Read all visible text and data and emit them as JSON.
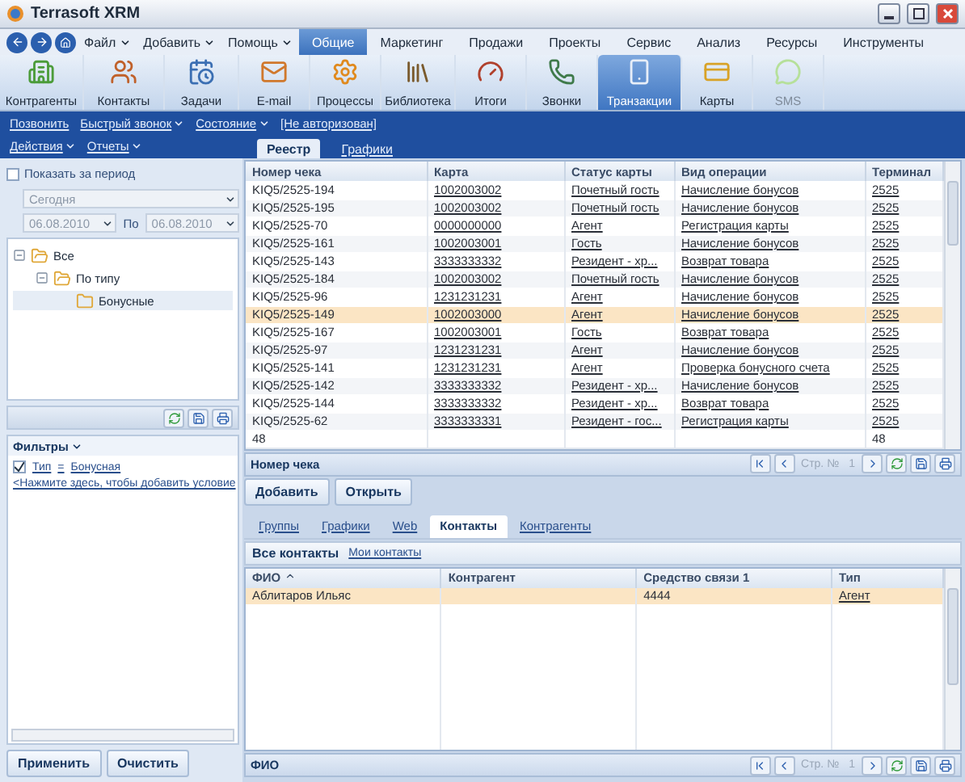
{
  "window": {
    "title": "Terrasoft XRM"
  },
  "menu": [
    {
      "label": "Файл",
      "dropdown": true
    },
    {
      "label": "Добавить",
      "dropdown": true
    },
    {
      "label": "Помощь",
      "dropdown": true
    }
  ],
  "sections": [
    {
      "label": "Общие",
      "selected": true
    },
    {
      "label": "Маркетинг",
      "selected": false
    },
    {
      "label": "Продажи",
      "selected": false
    },
    {
      "label": "Проекты",
      "selected": false
    },
    {
      "label": "Сервис",
      "selected": false
    },
    {
      "label": "Анализ",
      "selected": false
    },
    {
      "label": "Ресурсы",
      "selected": false
    },
    {
      "label": "Инструменты",
      "selected": false
    }
  ],
  "ribbon": [
    {
      "label": "Контрагенты",
      "selected": false,
      "disabled": false
    },
    {
      "label": "Контакты",
      "selected": false,
      "disabled": false
    },
    {
      "label": "Задачи",
      "selected": false,
      "disabled": false
    },
    {
      "label": "E-mail",
      "selected": false,
      "disabled": false
    },
    {
      "label": "Процессы",
      "selected": false,
      "disabled": false
    },
    {
      "label": "Библиотека",
      "selected": false,
      "disabled": false
    },
    {
      "label": "Итоги",
      "selected": false,
      "disabled": false
    },
    {
      "label": "Звонки",
      "selected": false,
      "disabled": false
    },
    {
      "label": "Транзакции",
      "selected": true,
      "disabled": false
    },
    {
      "label": "Карты",
      "selected": false,
      "disabled": false
    },
    {
      "label": "SMS",
      "selected": false,
      "disabled": true
    }
  ],
  "actions": {
    "row_1": [
      {
        "label": "Позвонить",
        "dropdown": false
      },
      {
        "label": "Быстрый звонок",
        "dropdown": true
      },
      {
        "label": "Состояние",
        "dropdown": true
      }
    ],
    "status": "[Не авторизован]",
    "row_2": [
      {
        "label": "Действия",
        "dropdown": true
      },
      {
        "label": "Отчеты",
        "dropdown": true
      }
    ]
  },
  "sidebar": {
    "period": {
      "label": "Показать за период",
      "checked": false
    },
    "range": "Сегодня",
    "from": "06.08.2010",
    "to_label": "По",
    "to": "06.08.2010",
    "tree": [
      {
        "label": "Все",
        "expanded": true,
        "selected": false,
        "children": [
          {
            "label": "По типу",
            "expanded": true,
            "selected": false,
            "children": [
              {
                "label": "Бонусные",
                "selected": true
              }
            ]
          }
        ]
      }
    ],
    "filters": {
      "title": "Фильтры",
      "conditions": [
        {
          "checked": true,
          "field": "Тип",
          "op": "=",
          "value": "Бонусная"
        }
      ],
      "add_hint": "<Нажмите здесь, чтобы добавить условие"
    },
    "buttons": [
      "Применить",
      "Очистить"
    ]
  },
  "main_tabs": [
    {
      "label": "Реестр",
      "selected": true
    },
    {
      "label": "Графики",
      "selected": false
    }
  ],
  "table": {
    "columns": [
      {
        "label": "Номер чека",
        "link": false
      },
      {
        "label": "Карта",
        "link": true
      },
      {
        "label": "Статус карты",
        "link": true
      },
      {
        "label": "Вид операции",
        "link": true
      },
      {
        "label": "Терминал",
        "link": true
      }
    ],
    "rows": [
      {
        "cells": [
          "KIQ5/2525-194",
          "1002003002",
          "Почетный гость",
          "Начисление бонусов",
          "2525"
        ],
        "selected": false
      },
      {
        "cells": [
          "KIQ5/2525-195",
          "1002003002",
          "Почетный гость",
          "Начисление бонусов",
          "2525"
        ],
        "selected": false
      },
      {
        "cells": [
          "KIQ5/2525-70",
          "0000000000",
          "Агент",
          "Регистрация карты",
          "2525"
        ],
        "selected": false
      },
      {
        "cells": [
          "KIQ5/2525-161",
          "1002003001",
          "Гость",
          "Начисление бонусов",
          "2525"
        ],
        "selected": false
      },
      {
        "cells": [
          "KIQ5/2525-143",
          "3333333332",
          "Резидент - хр...",
          "Возврат товара",
          "2525"
        ],
        "selected": false
      },
      {
        "cells": [
          "KIQ5/2525-184",
          "1002003002",
          "Почетный гость",
          "Начисление бонусов",
          "2525"
        ],
        "selected": false
      },
      {
        "cells": [
          "KIQ5/2525-96",
          "1231231231",
          "Агент",
          "Начисление бонусов",
          "2525"
        ],
        "selected": false
      },
      {
        "cells": [
          "KIQ5/2525-149",
          "1002003000",
          "Агент",
          "Начисление бонусов",
          "2525"
        ],
        "selected": true
      },
      {
        "cells": [
          "KIQ5/2525-167",
          "1002003001",
          "Гость",
          "Возврат товара",
          "2525"
        ],
        "selected": false
      },
      {
        "cells": [
          "KIQ5/2525-97",
          "1231231231",
          "Агент",
          "Начисление бонусов",
          "2525"
        ],
        "selected": false
      },
      {
        "cells": [
          "KIQ5/2525-141",
          "1231231231",
          "Агент",
          "Проверка бонусного счета",
          "2525"
        ],
        "selected": false
      },
      {
        "cells": [
          "KIQ5/2525-142",
          "3333333332",
          "Резидент - хр...",
          "Начисление бонусов",
          "2525"
        ],
        "selected": false
      },
      {
        "cells": [
          "KIQ5/2525-144",
          "3333333332",
          "Резидент - хр...",
          "Возврат товара",
          "2525"
        ],
        "selected": false
      },
      {
        "cells": [
          "KIQ5/2525-62",
          "3333333331",
          "Резидент - гос...",
          "Регистрация карты",
          "2525"
        ],
        "selected": false
      }
    ],
    "totals": {
      "column_1": "48",
      "column_5": "48"
    },
    "footer": "Номер чека",
    "pager": {
      "page_label": "Стр. №",
      "page": "1"
    }
  },
  "table_buttons": [
    "Добавить",
    "Открыть"
  ],
  "detail_tabs": [
    {
      "label": "Группы",
      "selected": false
    },
    {
      "label": "Графики",
      "selected": false
    },
    {
      "label": "Web",
      "selected": false
    },
    {
      "label": "Контакты",
      "selected": true
    },
    {
      "label": "Контрагенты",
      "selected": false
    }
  ],
  "contact_tabs": [
    {
      "label": "Все контакты",
      "selected": true
    },
    {
      "label": "Мои контакты",
      "selected": false
    }
  ],
  "contacts": {
    "columns": [
      {
        "label": "ФИО",
        "sorted_ascending": true,
        "link": false
      },
      {
        "label": "Контрагент",
        "sorted_ascending": false,
        "link": false
      },
      {
        "label": "Средство связи 1",
        "sorted_ascending": false,
        "link": false
      },
      {
        "label": "Тип",
        "sorted_ascending": false,
        "link": true
      }
    ],
    "rows": [
      {
        "cells": [
          "Аблитаров Ильяс",
          "",
          "4444",
          "Агент"
        ],
        "selected": true
      }
    ],
    "footer": "ФИО",
    "pager": {
      "page_label": "Стр. №",
      "page": "1"
    }
  }
}
